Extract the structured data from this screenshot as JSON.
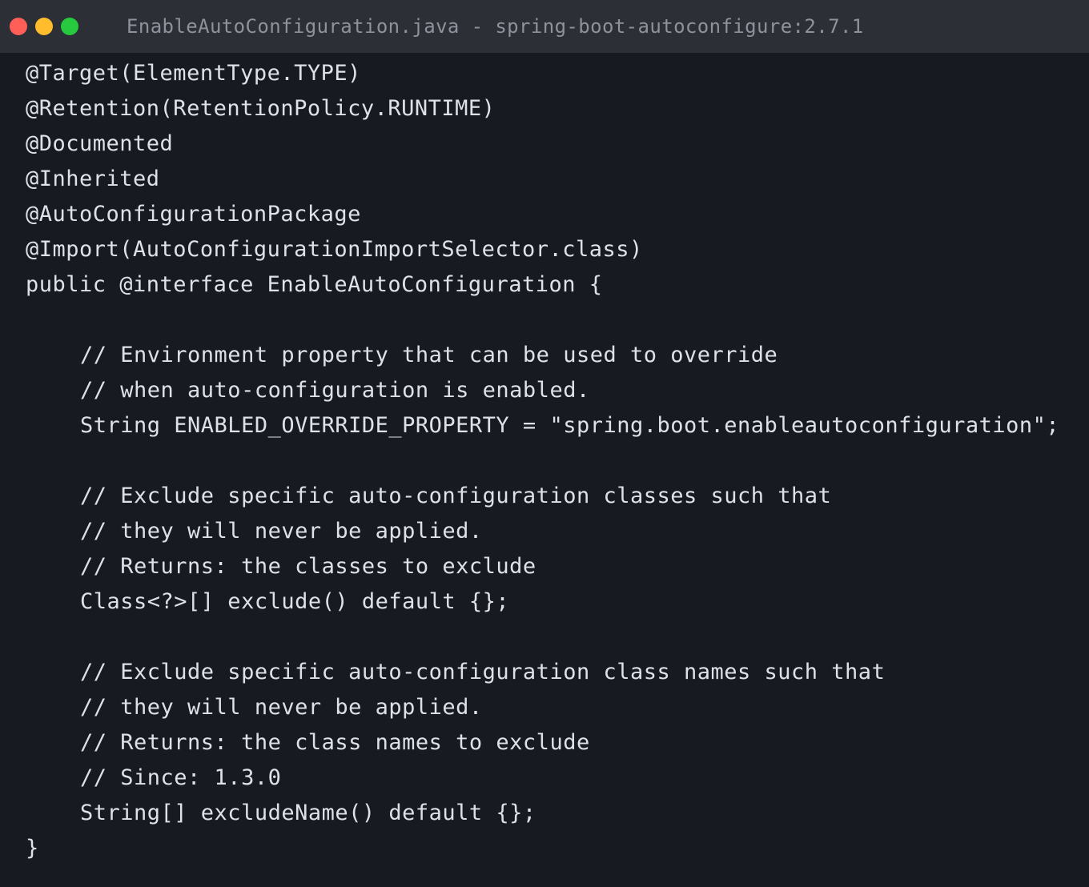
{
  "window": {
    "title": "EnableAutoConfiguration.java - spring-boot-autoconfigure:2.7.1"
  },
  "colors": {
    "background": "#181a22",
    "titlebar": "#2d2f37",
    "text": "#dfe1e8",
    "title_text": "#8f929b",
    "close": "#ff5f56",
    "minimize": "#ffbd2e",
    "maximize": "#27c93f"
  },
  "code": {
    "lines": [
      {
        "text": "@Target(ElementType.TYPE)",
        "indent": false
      },
      {
        "text": "@Retention(RetentionPolicy.RUNTIME)",
        "indent": false
      },
      {
        "text": "@Documented",
        "indent": false
      },
      {
        "text": "@Inherited",
        "indent": false
      },
      {
        "text": "@AutoConfigurationPackage",
        "indent": false
      },
      {
        "text": "@Import(AutoConfigurationImportSelector.class)",
        "indent": false
      },
      {
        "text": "public @interface EnableAutoConfiguration {",
        "indent": false
      },
      {
        "text": "",
        "indent": false
      },
      {
        "text": "// Environment property that can be used to override",
        "indent": true
      },
      {
        "text": "// when auto-configuration is enabled.",
        "indent": true
      },
      {
        "text": "String ENABLED_OVERRIDE_PROPERTY = \"spring.boot.enableautoconfiguration\";",
        "indent": true
      },
      {
        "text": "",
        "indent": false
      },
      {
        "text": "// Exclude specific auto-configuration classes such that",
        "indent": true
      },
      {
        "text": "// they will never be applied.",
        "indent": true
      },
      {
        "text": "// Returns: the classes to exclude",
        "indent": true
      },
      {
        "text": "Class<?>[] exclude() default {};",
        "indent": true
      },
      {
        "text": "",
        "indent": false
      },
      {
        "text": "// Exclude specific auto-configuration class names such that",
        "indent": true
      },
      {
        "text": "// they will never be applied.",
        "indent": true
      },
      {
        "text": "// Returns: the class names to exclude",
        "indent": true
      },
      {
        "text": "// Since: 1.3.0",
        "indent": true
      },
      {
        "text": "String[] excludeName() default {};",
        "indent": true
      },
      {
        "text": "}",
        "indent": false
      }
    ]
  }
}
